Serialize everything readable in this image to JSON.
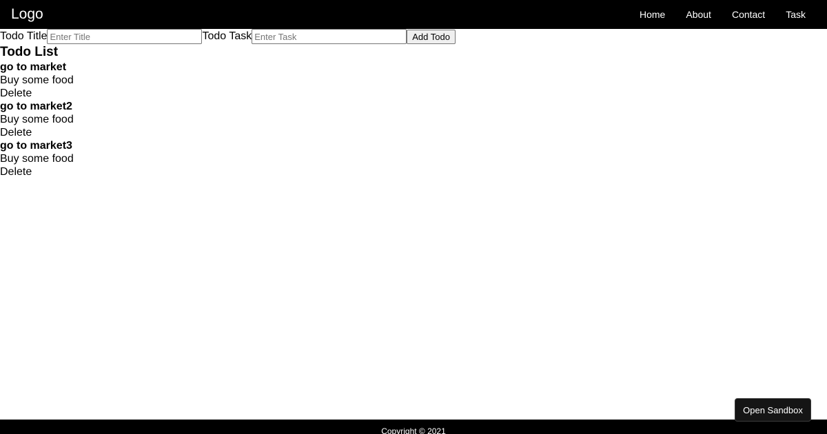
{
  "navbar": {
    "logo": "Logo",
    "links": [
      "Home",
      "About",
      "Contact",
      "Task"
    ]
  },
  "form": {
    "title_label": "Todo Title",
    "title_placeholder": "Enter Title",
    "task_label": "Todo Task",
    "task_placeholder": "Enter Task",
    "add_button": "Add Todo"
  },
  "todo_list": {
    "heading": "Todo List",
    "items": [
      {
        "title": "go to market",
        "task": "Buy some food",
        "delete_label": "Delete"
      },
      {
        "title": "go to market2",
        "task": "Buy some food",
        "delete_label": "Delete"
      },
      {
        "title": "go to market3",
        "task": "Buy some food",
        "delete_label": "Delete"
      }
    ]
  },
  "sandbox_button": "Open Sandbox",
  "footer": {
    "copyright": "Copyright © 2021"
  },
  "colors": {
    "navbar_bg": "#000000",
    "footer_bg": "#000000",
    "sandbox_bg": "#151515"
  }
}
